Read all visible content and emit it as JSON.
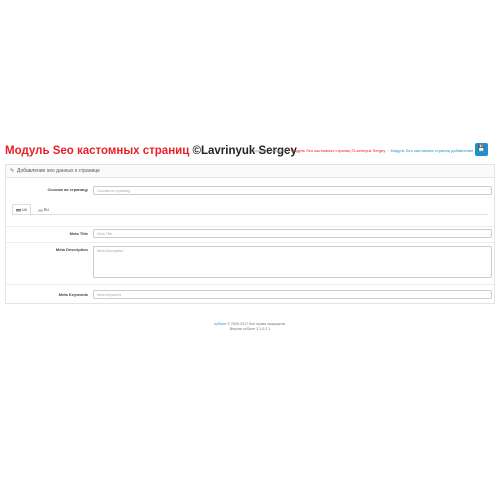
{
  "header": {
    "title_main": "Модуль Seo кастомных страниц ",
    "title_author": "©Lavrinyuk Sergey",
    "breadcrumb": [
      {
        "label": "Главная",
        "state": "normal"
      },
      {
        "label": "Модули",
        "state": "normal"
      },
      {
        "label": "Модуль Seo кастомных страниц ©Lavrinyuk Sergey",
        "state": "active"
      },
      {
        "label": "Модуль Seo кастомных страниц добавление",
        "state": "link"
      }
    ],
    "breadcrumb_separator": "/",
    "save_icon": "save-icon",
    "save_glyph": "💾"
  },
  "panel": {
    "heading": "Добавление seo данных к странице",
    "fields": {
      "url": {
        "label": "Ссылка на страницу",
        "placeholder": "Ссылка на страницу"
      },
      "meta_title": {
        "label": "Meta Title",
        "placeholder": "Meta Title"
      },
      "meta_description": {
        "label": "Meta Description",
        "placeholder": "Meta Description"
      },
      "meta_keywords": {
        "label": "Meta Keywords",
        "placeholder": "Meta Keywords"
      }
    },
    "languages": [
      {
        "code": "UA",
        "flag": "flag-ua",
        "active": true
      },
      {
        "code": "RU",
        "flag": "flag-ru",
        "active": false
      }
    ]
  },
  "footer": {
    "brand": "ocStore",
    "copyright": " © 2009-2017 Все права защищены.",
    "version": "Версия ocStore 2.1.0.2.1"
  },
  "colors": {
    "title_red": "#e8202a",
    "accent_blue": "#1e91cf"
  }
}
